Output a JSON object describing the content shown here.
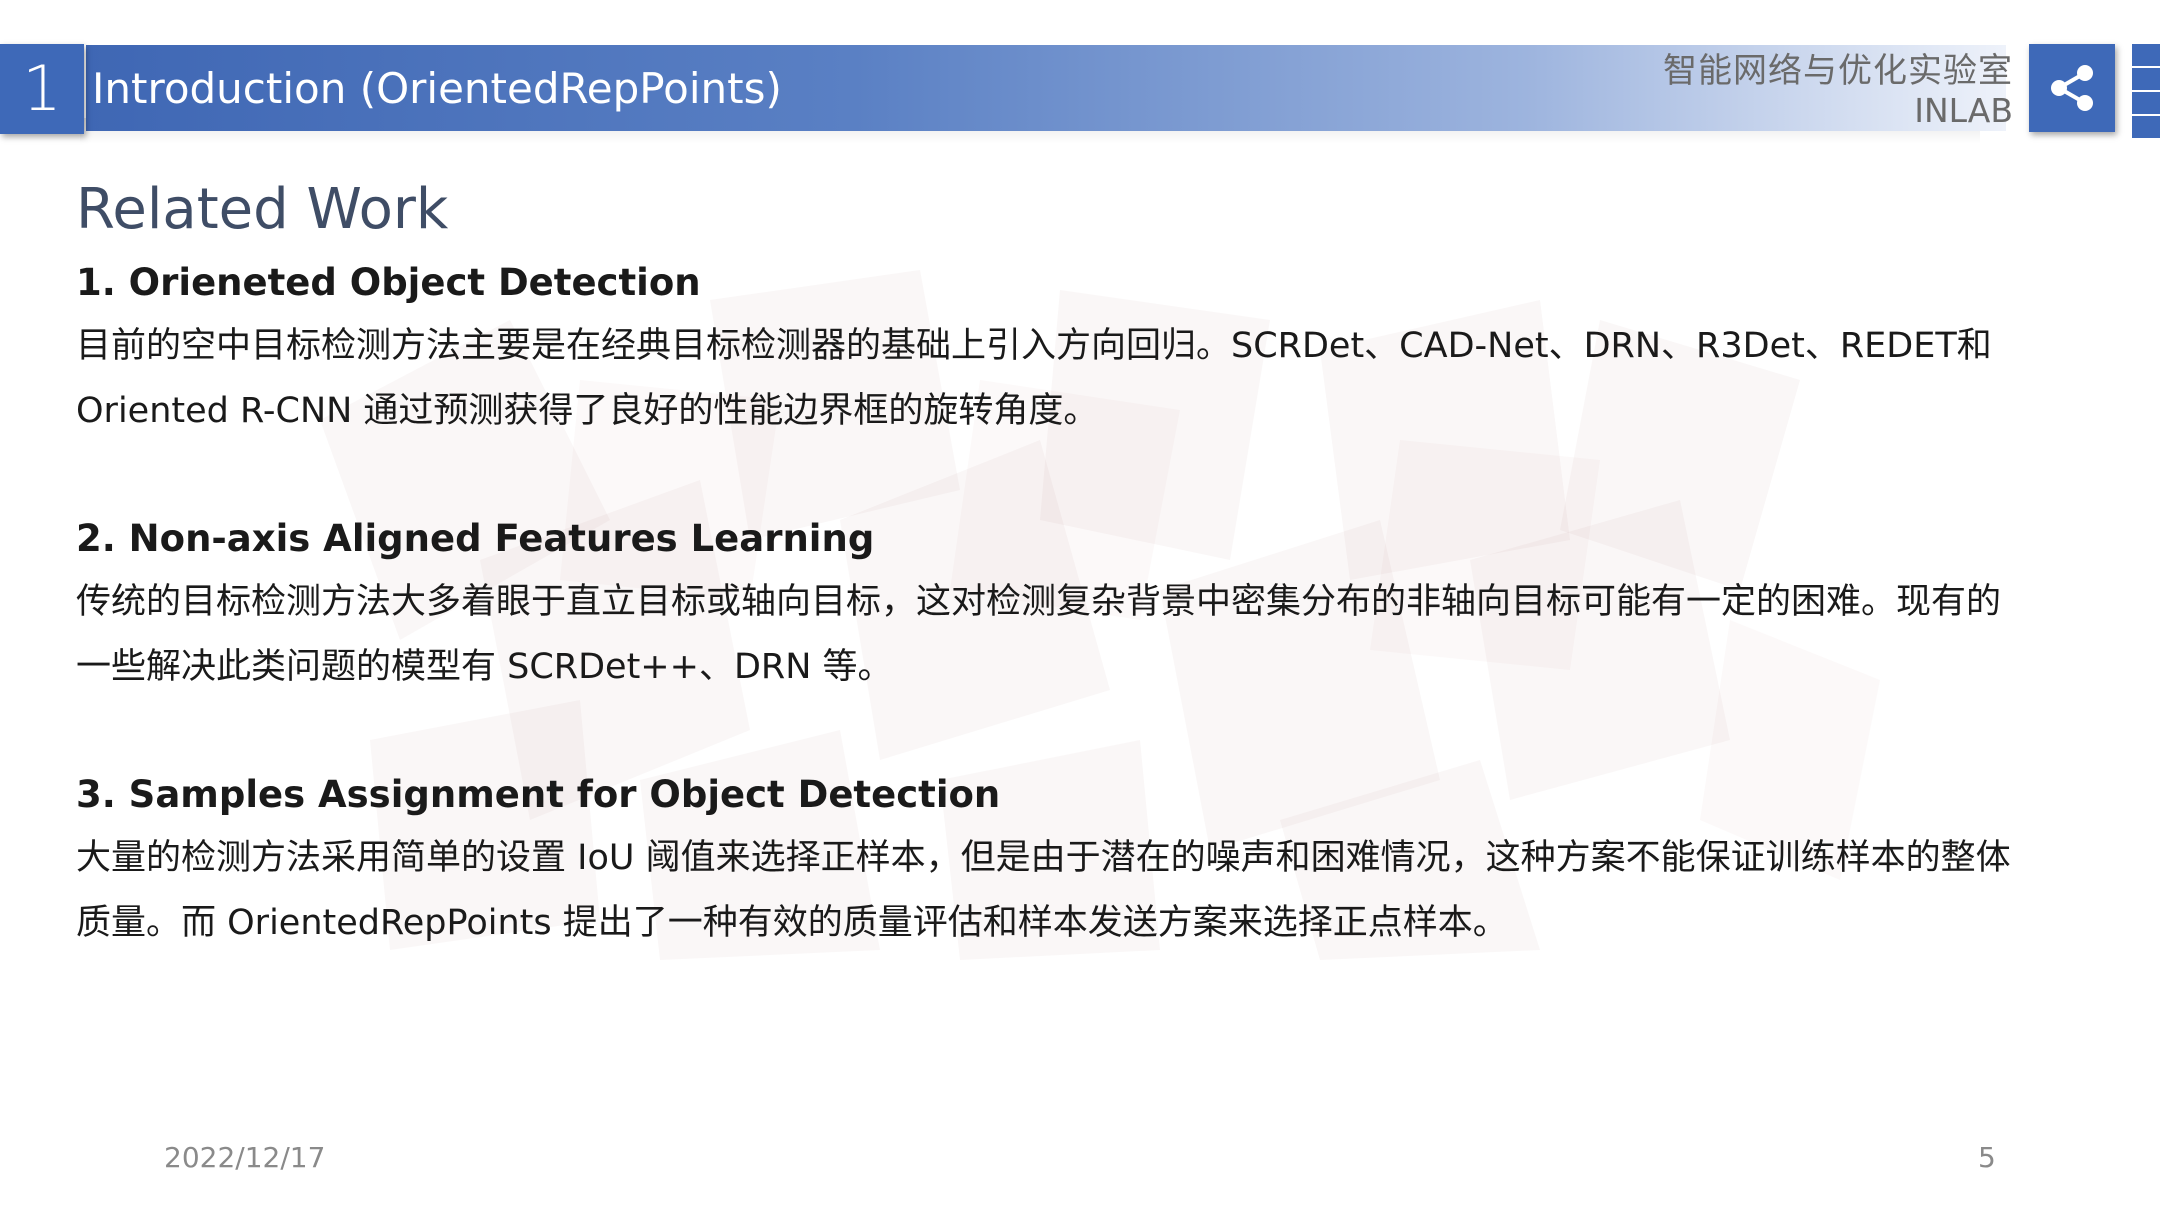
{
  "header": {
    "section_number": "1",
    "title": "Introduction (OrientedRepPoints)",
    "lab_name_cn": "智能网络与优化实验室",
    "lab_name_en": "INLAB",
    "share_icon": "share-icon",
    "accent_color": "#3e69b8"
  },
  "content": {
    "heading": "Related Work",
    "items": [
      {
        "title": "1. Orieneted Object Detection",
        "lines": [
          "目前的空中目标检测方法主要是在经典目标检测器的基础上引入方向回归。SCRDet、CAD-Net、DRN、R3Det、REDET和",
          "Oriented R-CNN 通过预测获得了良好的性能边界框的旋转角度。"
        ]
      },
      {
        "title": "2. Non-axis Aligned Features Learning",
        "lines": [
          "传统的目标检测方法大多着眼于直立目标或轴向目标，这对检测复杂背景中密集分布的非轴向目标可能有一定的困难。现有的",
          "一些解决此类问题的模型有 SCRDet++、DRN 等。"
        ]
      },
      {
        "title": "3. Samples Assignment for Object Detection",
        "lines": [
          "大量的检测方法采用简单的设置 IoU 阈值来选择正样本，但是由于潜在的噪声和困难情况，这种方案不能保证训练样本的整体",
          "质量。而 OrientedRepPoints 提出了一种有效的质量评估和样本发送方案来选择正点样本。"
        ]
      }
    ]
  },
  "footer": {
    "date": "2022/12/17",
    "page_number": "5"
  }
}
